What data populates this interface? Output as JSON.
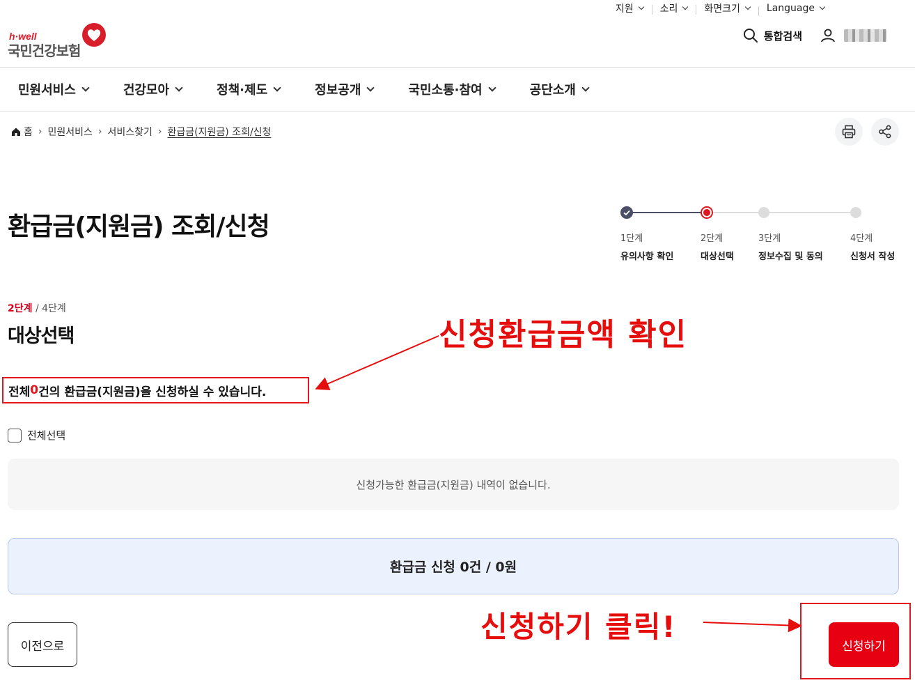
{
  "util_bar": {
    "items": [
      "지원",
      "소리",
      "화면크기",
      "Language"
    ]
  },
  "header": {
    "logo_top": "h·well",
    "logo_name": "국민건강보험",
    "search_label": "통합검색",
    "colors": {
      "brand_red": "#d81e2a"
    }
  },
  "gnb": {
    "items": [
      "민원서비스",
      "건강모아",
      "정책·제도",
      "정보공개",
      "국민소통·참여",
      "공단소개"
    ]
  },
  "breadcrumb": {
    "home": "홈",
    "items": [
      "민원서비스",
      "서비스찾기",
      "환급금(지원금) 조회/신청"
    ]
  },
  "page": {
    "title": "환급금(지원금) 조회/신청"
  },
  "stepper": {
    "steps": [
      {
        "num": "1단계",
        "label": "유의사항 확인",
        "state": "done"
      },
      {
        "num": "2단계",
        "label": "대상선택",
        "state": "current"
      },
      {
        "num": "3단계",
        "label": "정보수집 및 동의",
        "state": "todo"
      },
      {
        "num": "4단계",
        "label": "신청서 작성",
        "state": "todo"
      }
    ]
  },
  "step_info": {
    "current": "2단계",
    "total": "/ 4단계",
    "title": "대상선택"
  },
  "summary": {
    "prefix": "전체 ",
    "count": "0",
    "suffix": "건의 환급금(지원금)을 신청하실 수 있습니다."
  },
  "select_all_label": "전체선택",
  "empty_message": "신청가능한 환급금(지원금) 내역이 없습니다.",
  "total_text": "환급금 신청 0건 / 0원",
  "buttons": {
    "prev": "이전으로",
    "apply": "신청하기"
  },
  "annotations": {
    "check_amount": "신청환급금액 확인",
    "click_apply": "신청하기 클릭!"
  }
}
